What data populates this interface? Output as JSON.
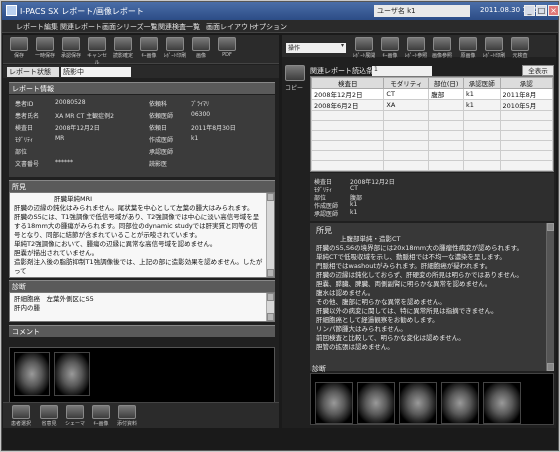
{
  "window": {
    "title": "I-PACS SX レポート/画像レポート",
    "user_field": "ユーザ名 k1",
    "datetime": "2011.08.30 13:54",
    "controls": [
      "_",
      "□",
      "×"
    ]
  },
  "menu": [
    "レポート編集",
    "関連レポート画面",
    "シリーズ一覧",
    "関連検査一覧",
    "画面レイアウト",
    "オプション"
  ],
  "left_toolbar": [
    "保存",
    "一時保存",
    "承認保存",
    "キャンセル",
    "読影確定",
    "ｷｰ画像",
    "ﾚﾎﾟｰﾄ印刷",
    "画像",
    "PDF"
  ],
  "status": {
    "label": "レポート状態",
    "value": "読影中"
  },
  "report_info": {
    "header": "レポート情報",
    "rows": [
      [
        "患者ID",
        "20080528",
        "依頼科",
        "ﾌﾟﾗｲﾏﾘ"
      ],
      [
        "患者氏名",
        "XA MR CT 主観症例2",
        "依頼医師",
        "06300"
      ],
      [
        "検査日",
        "2008年12月2日",
        "依頼日",
        "2011年8月30日"
      ],
      [
        "ﾓﾀﾞﾘﾃｨ",
        "MR",
        "作成医師",
        "k1"
      ],
      [
        "部位",
        "",
        "承認医師",
        ""
      ],
      [
        "文書番号",
        "******",
        "読影医",
        ""
      ]
    ]
  },
  "findings": {
    "header": "所見",
    "title": "肝臓単純MRI",
    "lines": [
      "肝臓の辺縁の鈍化はみられません。尾状葉を中心として左葉の腫大はみられます。",
      "肝臓のS5には、T1強調像で低信号域があり、T2強調像では中心に淡い高信号域を呈する18mm大の腫瘍がみられます。同部位のdynamic studyでは肝実質と同等の信号となり、同部に結節が含まれていることが示唆されています。",
      "単純T2強調像において、腫瘍の辺縁に異常な高信号域を認めません。",
      "胆嚢が描出されていません。",
      "造影剤注入後の脂肪抑制T1強調像後では、上記の部に造影効果を認めません。したがって"
    ]
  },
  "diagnosis": {
    "header": "診断",
    "lines": [
      "肝細胞癌　左葉外側区にS5",
      "肝内の腫"
    ]
  },
  "comment": {
    "header": "コメント",
    "text": ""
  },
  "bottom_toolbar": [
    "患者選択",
    "省意見",
    "シェーマ",
    "ｷｰ画像",
    "添付資料"
  ],
  "right_toolbar": {
    "combo_label": "操作",
    "buttons": [
      "ﾚﾎﾟｰﾄ展開",
      "ｷｰ画像",
      "ﾚﾎﾟｰﾄ参照",
      "画像参照",
      "原画像",
      "ﾚﾎﾟｰﾄ印刷",
      "元検査"
    ]
  },
  "related": {
    "icon_label": "コピー",
    "search_label": "関連レポート読込条件",
    "search_value": "1",
    "all_button": "全表示",
    "columns": [
      "検査日",
      "モダリティ",
      "部位(日)",
      "承認医師",
      "承認"
    ],
    "rows": [
      [
        "2008年12月2日",
        "CT",
        "腹部",
        "k1",
        "2011年8月"
      ],
      [
        "2008年6月2日",
        "XA",
        "",
        "k1",
        "2010年5月"
      ]
    ]
  },
  "related_info": {
    "rows": [
      [
        "検査日",
        "2008年12月2日"
      ],
      [
        "ﾓﾀﾞﾘﾃｨ",
        "CT"
      ],
      [
        "部位",
        "腹部"
      ],
      [
        "作成医師",
        "k1"
      ],
      [
        "承認医師",
        "k1"
      ]
    ]
  },
  "related_findings": {
    "header": "所見",
    "title": "上腹部単純・造影CT",
    "lines": [
      "肝臓のS5,S6の境界部には20x18mm大の腫瘤性病変が認められます。",
      "単純CTで低吸収域を示し、動脈相では不均一な濃染を呈します。",
      "門脈相ではwashoutがみられます。肝細胞癌が疑われます。",
      "肝臓の辺縁は鈍化しておらず、肝硬変の所見は明らかではありません。",
      "胆嚢、膵臓、脾臓、両側副腎に明らかな異常を認めません。",
      "腹水は認めません。",
      "その他、腹部に明らかな異常を認めません。",
      "肝臓以外の病変に関しては、特に異常所見は指摘できません。",
      "肝細胞癌として経過観察をお勧めします。",
      "リンパ節腫大はみられません。",
      "前回検査と比較して、明らかな変化は認めません。",
      "胆管の拡張は認めません。"
    ],
    "diag_header": "診断"
  }
}
